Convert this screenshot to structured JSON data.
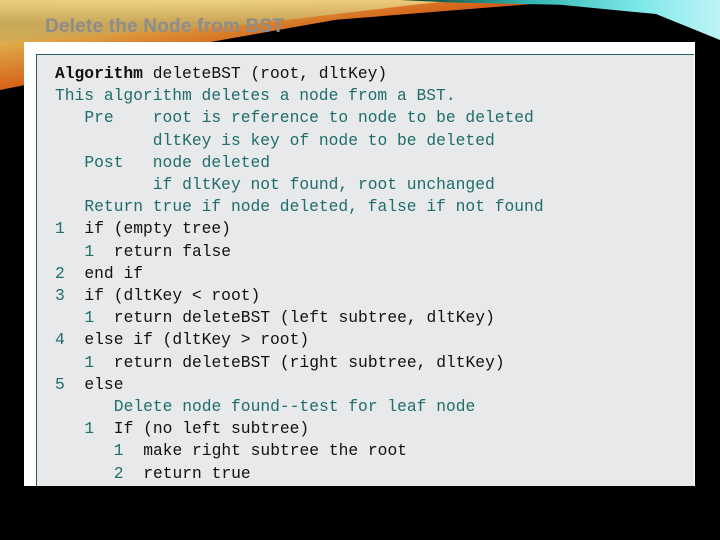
{
  "slide": {
    "title": "Delete the Node from BST"
  },
  "algorithm": {
    "lines": [
      {
        "num": "",
        "keyword": "Algorithm",
        "text": " deleteBST (root, dltKey)",
        "indent": 0,
        "style": "header"
      },
      {
        "num": "",
        "keyword": "",
        "text": "This algorithm deletes a node from a BST.",
        "indent": 0,
        "style": "comment"
      },
      {
        "num": "",
        "keyword": "",
        "text": "Pre    root is reference to node to be deleted",
        "indent": 2,
        "style": "comment"
      },
      {
        "num": "",
        "keyword": "",
        "text": "       dltKey is key of node to be deleted",
        "indent": 2,
        "style": "comment"
      },
      {
        "num": "",
        "keyword": "",
        "text": "Post   node deleted",
        "indent": 2,
        "style": "comment"
      },
      {
        "num": "",
        "keyword": "",
        "text": "       if dltKey not found, root unchanged",
        "indent": 2,
        "style": "comment"
      },
      {
        "num": "",
        "keyword": "",
        "text": "Return true if node deleted, false if not found",
        "indent": 2,
        "style": "comment"
      },
      {
        "num": "1",
        "keyword": "",
        "text": "if (empty tree)",
        "indent": 0,
        "style": "code"
      },
      {
        "num": "1",
        "keyword": "",
        "text": "return false",
        "indent": 2,
        "style": "code"
      },
      {
        "num": "2",
        "keyword": "",
        "text": "end if",
        "indent": 0,
        "style": "code"
      },
      {
        "num": "3",
        "keyword": "",
        "text": "if (dltKey < root)",
        "indent": 0,
        "style": "code"
      },
      {
        "num": "1",
        "keyword": "",
        "text": "return deleteBST (left subtree, dltKey)",
        "indent": 2,
        "style": "code"
      },
      {
        "num": "4",
        "keyword": "",
        "text": "else if (dltKey > root)",
        "indent": 0,
        "style": "code"
      },
      {
        "num": "1",
        "keyword": "",
        "text": "return deleteBST (right subtree, dltKey)",
        "indent": 2,
        "style": "code"
      },
      {
        "num": "5",
        "keyword": "",
        "text": "else",
        "indent": 0,
        "style": "code"
      },
      {
        "num": "",
        "keyword": "",
        "text": "Delete node found--test for leaf node",
        "indent": 3,
        "style": "comment"
      },
      {
        "num": "1",
        "keyword": "",
        "text": "If (no left subtree)",
        "indent": 2,
        "style": "code"
      },
      {
        "num": "1",
        "keyword": "",
        "text": "make right subtree the root",
        "indent": 4,
        "style": "code"
      },
      {
        "num": "2",
        "keyword": "",
        "text": "return true",
        "indent": 4,
        "style": "code"
      }
    ]
  }
}
